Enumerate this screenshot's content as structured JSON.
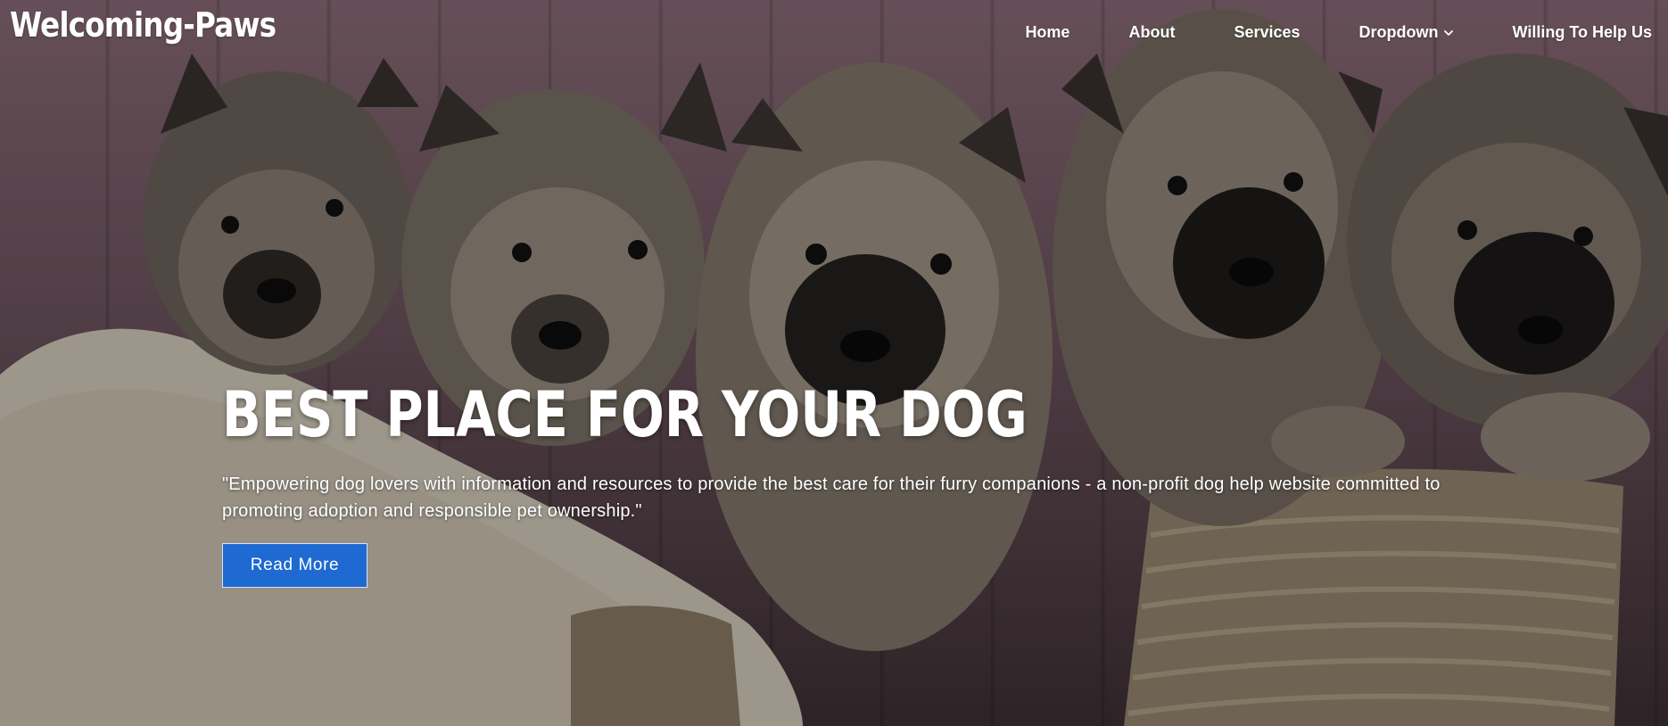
{
  "site": {
    "logo": "Welcoming-Paws"
  },
  "nav": {
    "items": [
      {
        "label": "Home"
      },
      {
        "label": "About"
      },
      {
        "label": "Services"
      },
      {
        "label": "Dropdown",
        "icon": "chevron-down-icon"
      },
      {
        "label": "Willing To Help Us"
      }
    ]
  },
  "hero": {
    "image": "five-fluffy-puppies-in-wicker-basket",
    "headline": "BEST PLACE FOR YOUR DOG",
    "description": "\"Empowering dog lovers with information and resources to provide the best care for their furry companions - a non-profit dog help website committed to promoting adoption and responsible pet ownership.\"",
    "cta_label": "Read More"
  },
  "colors": {
    "accent": "#1e6ad2",
    "text": "#ffffff"
  }
}
